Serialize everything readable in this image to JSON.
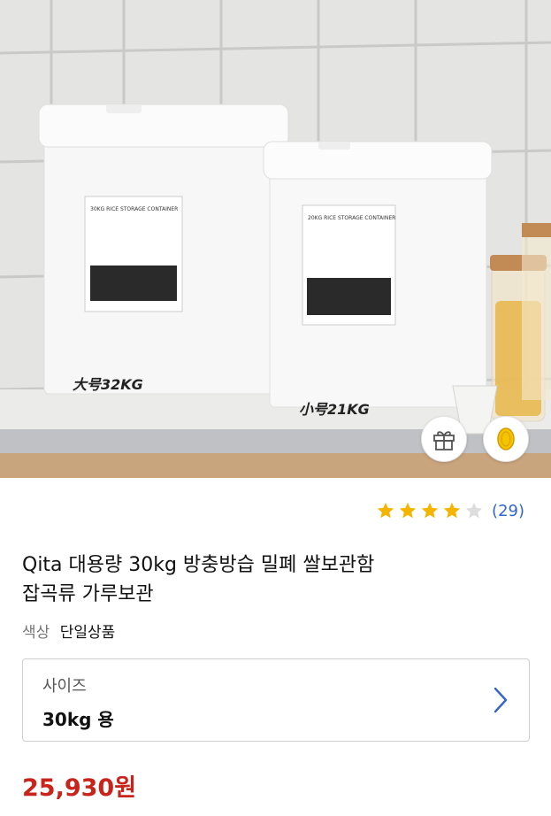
{
  "hero": {
    "large_label": "大号32KG",
    "small_label": "小号21KG",
    "large_box_text": "30KG RICE STORAGE CONTAINER",
    "small_box_text": "20KG RICE STORAGE CONTAINER",
    "icons": {
      "gift": "gift-icon",
      "coin": "coin-icon"
    }
  },
  "rating": {
    "stars": 4,
    "max_stars": 5,
    "review_count": "(29)",
    "star_color": "#f5b400",
    "empty_star_color": "#dddddd"
  },
  "product": {
    "title_line1": "Qita 대용량 30kg 방충방습 밀폐 쌀보관함",
    "title_line2": "잡곡류 가루보관",
    "color_label": "색상",
    "color_value": "단일상품"
  },
  "size_option": {
    "label": "사이즈",
    "value": "30kg 용",
    "chevron": "chevron-right-icon",
    "chevron_color": "#3366cc"
  },
  "price": {
    "text": "25,930원",
    "color": "#c9241b"
  }
}
